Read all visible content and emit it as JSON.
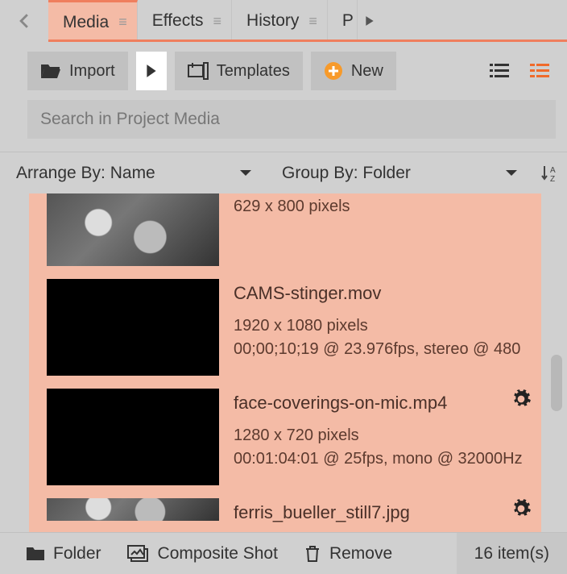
{
  "tabs": [
    {
      "label": "Media"
    },
    {
      "label": "Effects"
    },
    {
      "label": "History"
    },
    {
      "label": "P"
    }
  ],
  "toolbar": {
    "import": "Import",
    "templates": "Templates",
    "new_label": "New"
  },
  "search": {
    "placeholder": "Search in Project Media"
  },
  "arrange": {
    "arrange_by": "Arrange By: Name",
    "group_by": "Group By: Folder"
  },
  "items": [
    {
      "dims": "629 x 800 pixels"
    },
    {
      "title": "CAMS-stinger.mov",
      "dims": "1920 x 1080 pixels",
      "details": "00;00;10;19 @ 23.976fps, stereo @ 480"
    },
    {
      "title": "face-coverings-on-mic.mp4",
      "dims": "1280 x 720 pixels",
      "details": "00:01:04:01 @ 25fps, mono @ 32000Hz"
    },
    {
      "title": "ferris_bueller_still7.jpg"
    }
  ],
  "bottom": {
    "folder": "Folder",
    "composite": "Composite Shot",
    "remove": "Remove",
    "count": "16 item(s)"
  }
}
